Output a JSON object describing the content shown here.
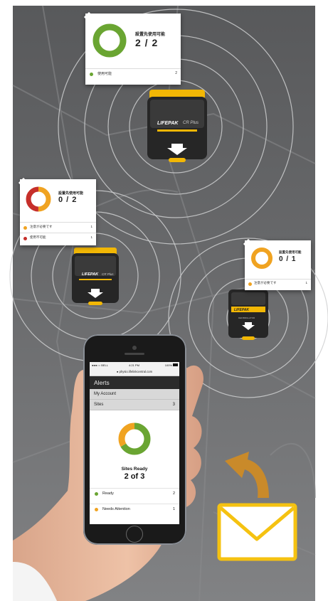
{
  "colors": {
    "ready": "#6aa532",
    "attention": "#f0a321",
    "notready": "#c62f2a",
    "brand_yellow": "#f2b705",
    "envelope": "#f5c211"
  },
  "cards": [
    {
      "title": "設置先使用可能",
      "ratio": "2 / 2",
      "rows": [
        {
          "status": "ready",
          "label": "使用可能",
          "count": "2"
        }
      ],
      "donut": {
        "ready": 2,
        "attention": 0,
        "not_ready": 0
      }
    },
    {
      "title": "設置先使用可能",
      "ratio": "0 / 2",
      "rows": [
        {
          "status": "attention",
          "label": "注意が必要です",
          "count": "1"
        },
        {
          "status": "not_ready",
          "label": "使用不可能",
          "count": "1"
        }
      ],
      "donut": {
        "ready": 0,
        "attention": 1,
        "not_ready": 1
      }
    },
    {
      "title": "設置先使用可能",
      "ratio": "0 / 1",
      "rows": [
        {
          "status": "attention",
          "label": "注意が必要です",
          "count": "1"
        }
      ],
      "donut": {
        "ready": 0,
        "attention": 1,
        "not_ready": 0
      }
    }
  ],
  "device": {
    "brand": "LIFEPAK",
    "model": "CR Plus",
    "subtitle": "DEFIBRILLATOR"
  },
  "phone": {
    "status_carrier": "●●●○○ BELL",
    "status_time": "4:21 PM",
    "status_battery": "100%",
    "url": "physio.lifelinkcentral.com",
    "header": "Alerts",
    "menu": [
      {
        "label": "My Account",
        "count": ""
      },
      {
        "label": "Sites",
        "count": "3"
      }
    ],
    "summary_title": "Sites Ready",
    "summary_ratio": "2 of 3",
    "donut": {
      "ready": 2,
      "attention": 1
    },
    "rows": [
      {
        "status": "ready",
        "label": "Ready",
        "count": "2"
      },
      {
        "status": "attention",
        "label": "Needs Attention",
        "count": "1"
      }
    ]
  }
}
